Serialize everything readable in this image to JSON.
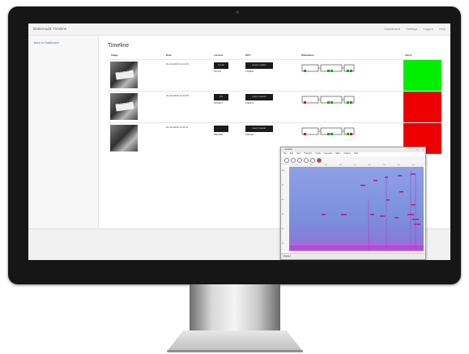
{
  "app": {
    "brand": "BrakeAudit: Timeline",
    "nav": [
      "Dashboard",
      "Settings",
      "Logout",
      "Help"
    ],
    "back_link": "Back to Dashboard",
    "page_title": "Timeline",
    "columns": [
      "Image",
      "Date",
      "License",
      "DOT",
      "Wheelbase",
      "Alerts"
    ],
    "rows": [
      {
        "thumb_text": "BRAKE AUDIT",
        "date": "04-10-2018 11:21:26",
        "license_plate": "DJT 447",
        "license_text": "DJT447",
        "dot_plate": "US DOT 2740822",
        "dot_text": "2740822",
        "alert_color": "#00ee00",
        "alert_label": ""
      },
      {
        "thumb_text": "BRAKE AUDIT",
        "date": "04-10-2018 11:22:58",
        "license_plate": "KZV",
        "license_text": "KZV3072",
        "dot_plate": "USDOT 1482279",
        "dot_text": "1482279",
        "alert_color": "#ee0000",
        "alert_label": "Brakes Invalid"
      },
      {
        "thumb_text": "",
        "date": "04-10-2018 11:24:47",
        "license_plate": "",
        "license_text": "RBL6258",
        "dot_plate": "USDOT 2040187",
        "dot_text": "2040187",
        "alert_color": "#ee0000",
        "alert_label": "Brakes Invalid"
      }
    ]
  },
  "spectrogram": {
    "title": "Audacity",
    "menu": [
      "File",
      "Edit",
      "View",
      "Transport",
      "Tracks",
      "Generate",
      "Effect",
      "Analyze",
      "Help"
    ],
    "ruler": [
      "1.0",
      "2.0",
      "3.0",
      "4.0",
      "5.0",
      "6.0",
      "7.0",
      "8.0",
      "9.0"
    ],
    "yaxis": [
      "10k",
      "8k",
      "6k",
      "4k",
      "2k",
      "1k"
    ],
    "status": "Stopped.",
    "colors": {
      "background": "#7d8fe0",
      "low_band": "#c85bd8",
      "tones": "#c0148c"
    }
  },
  "screen_colors": {
    "navbar": "#f3f3f3",
    "sidebar": "#f7f7f7",
    "accent_link": "#3377cc"
  },
  "icons": [
    "camera-icon",
    "minimize-icon",
    "maximize-icon",
    "close-icon",
    "play-icon",
    "pause-icon",
    "stop-icon",
    "record-icon"
  ]
}
